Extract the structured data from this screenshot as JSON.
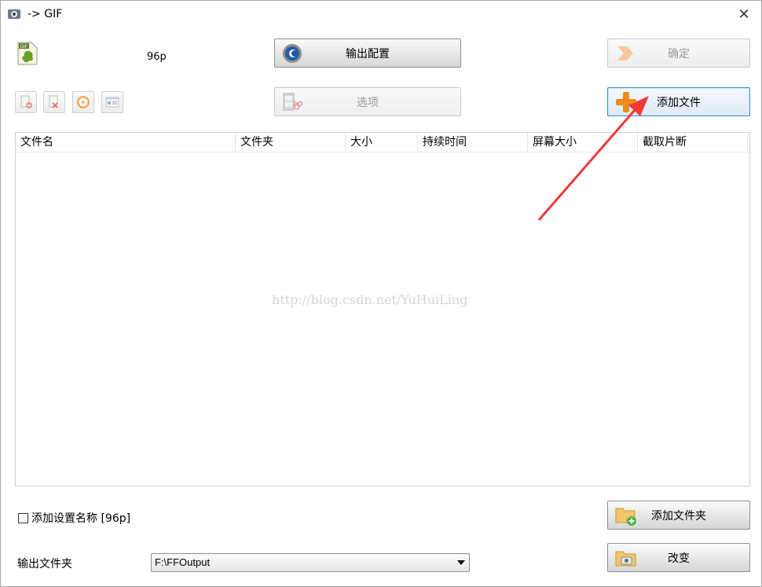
{
  "window": {
    "title": "-> GIF"
  },
  "preset": {
    "name": "96p",
    "icon": "gif-file-icon"
  },
  "toolbar": {
    "output_config_label": "输出配置",
    "confirm_label": "确定",
    "options_label": "选项",
    "add_file_label": "添加文件"
  },
  "file_list": {
    "columns": [
      "文件名",
      "文件夹",
      "大小",
      "持续时间",
      "屏幕大小",
      "截取片断"
    ],
    "rows": [],
    "watermark": "http://blog.csdn.net/YuHuiLing"
  },
  "footer": {
    "add_preset_name_label": "添加设置名称 [96p]",
    "add_preset_name_checked": false,
    "add_folder_label": "添加文件夹",
    "output_folder_label": "输出文件夹",
    "output_folder_value": "F:\\FFOutput",
    "change_label": "改变"
  },
  "colors": {
    "annotation_arrow": "#f0383a",
    "add_icon": "#f08a1c"
  }
}
